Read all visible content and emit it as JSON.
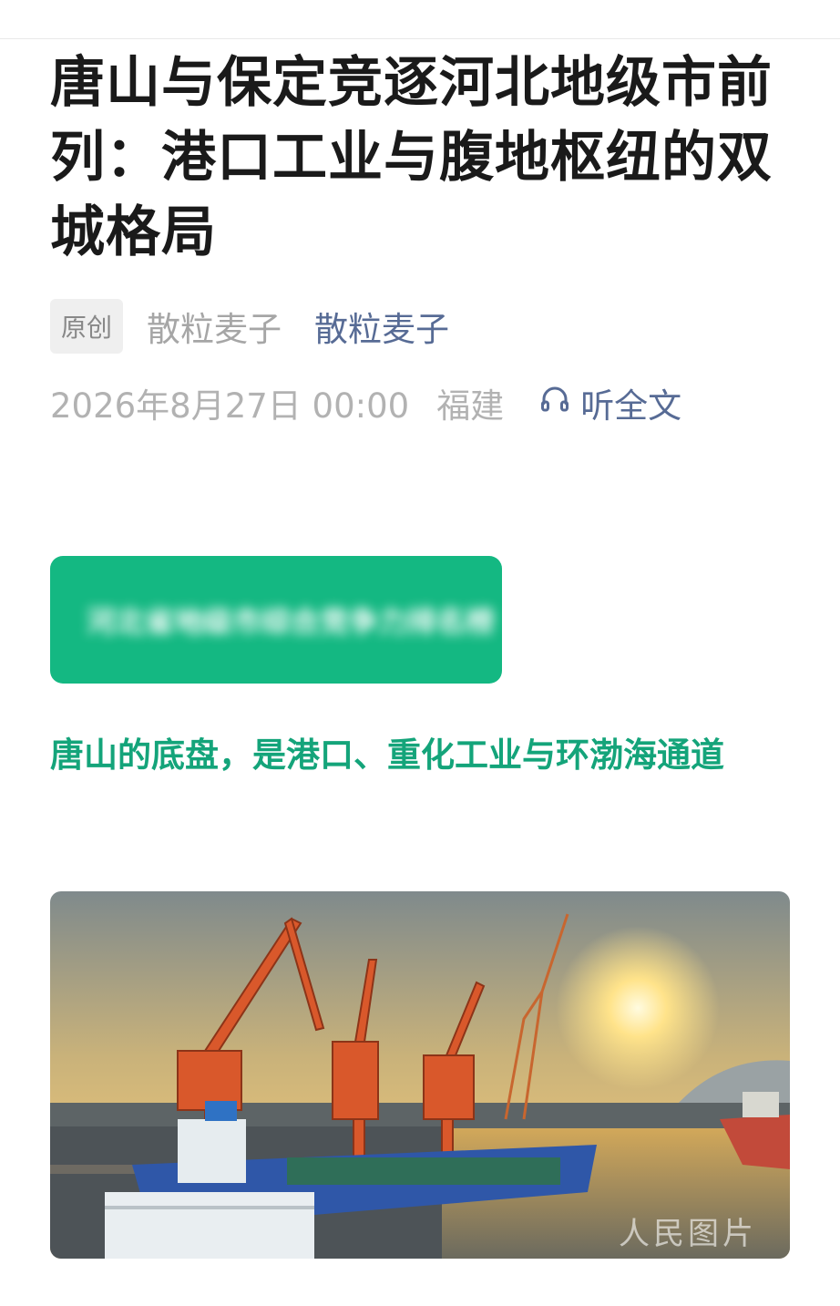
{
  "article": {
    "title": "唐山与保定竞逐河北地级市前列：港口工业与腹地枢纽的双城格局",
    "badge": "原创",
    "author_name": "散粒麦子",
    "account_name": "散粒麦子",
    "date": "2026年8月27日 00:00",
    "location": "福建",
    "listen_label": "听全文",
    "card_text": "河北省地级市综合竞争力排名榜",
    "subheading": "唐山的底盘，是港口、重化工业与环渤海通道",
    "image_watermark": "人民图片"
  },
  "colors": {
    "accent_green": "#14b882",
    "subheading_green": "#14a47a",
    "link_blue": "#576b95"
  },
  "icons": {
    "listen": "headphones-icon"
  }
}
